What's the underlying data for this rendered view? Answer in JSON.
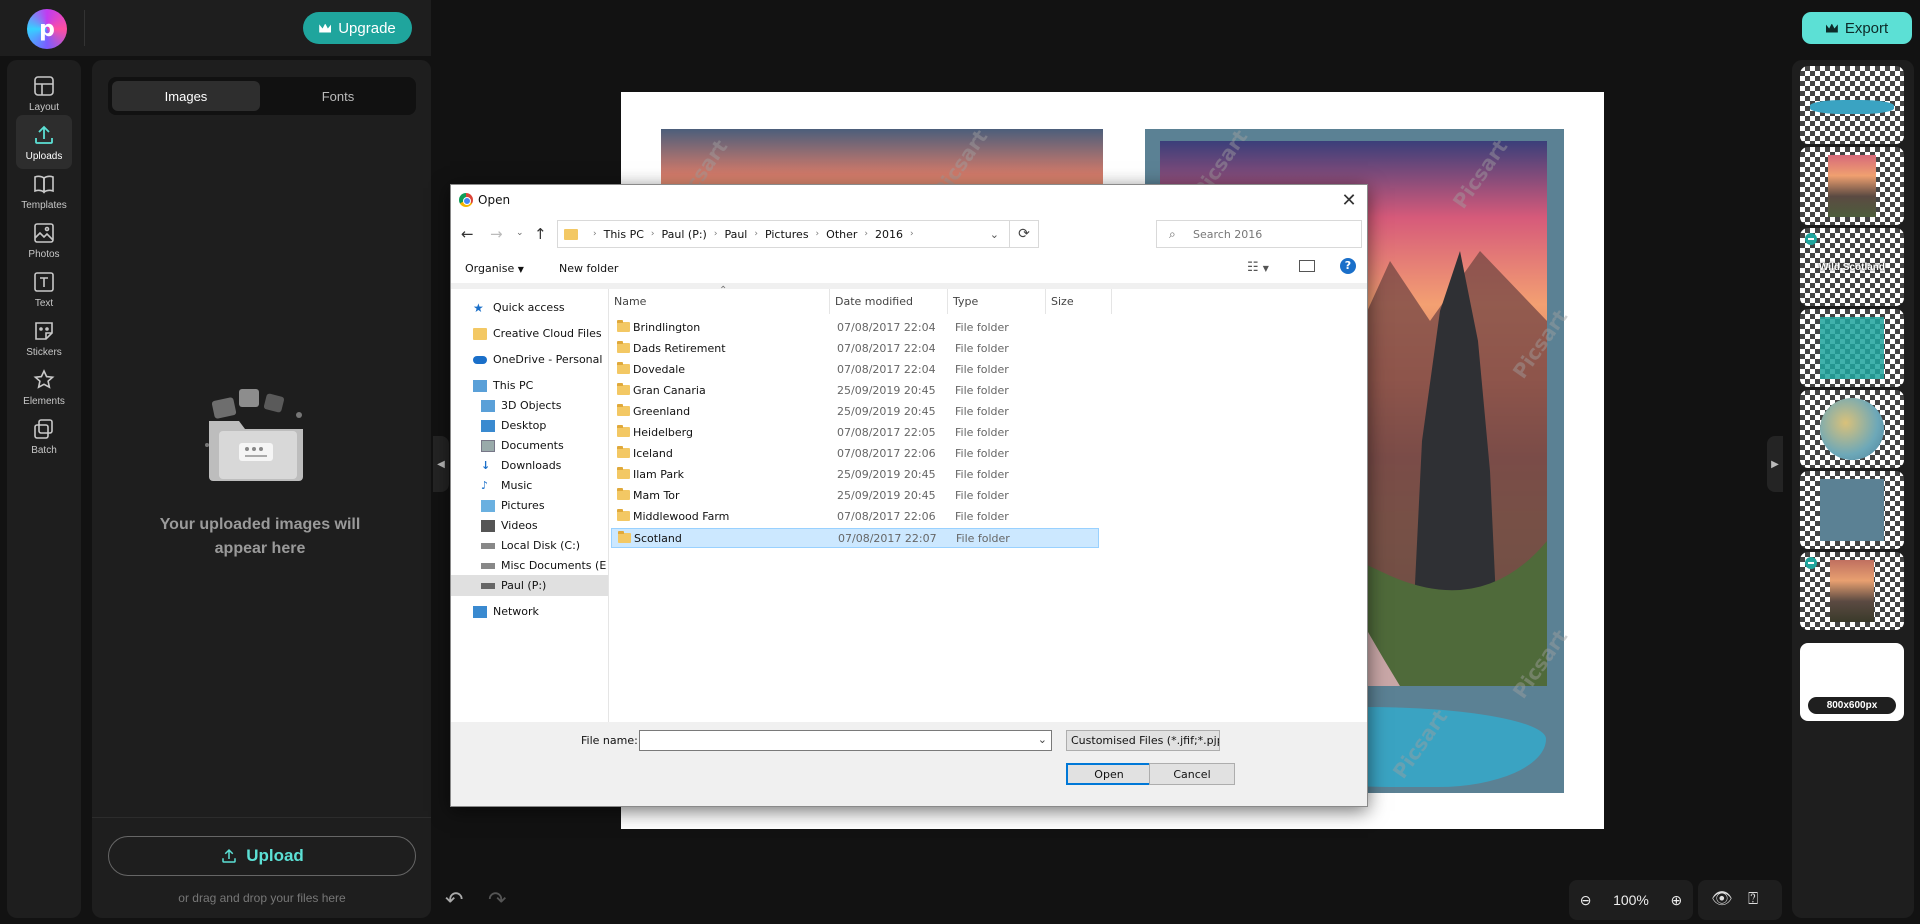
{
  "app": {
    "upgrade_label": "Upgrade",
    "export_label": "Export"
  },
  "rail": [
    {
      "label": "Layout",
      "icon": "layout-icon"
    },
    {
      "label": "Uploads",
      "icon": "upload-icon",
      "active": true
    },
    {
      "label": "Templates",
      "icon": "templates-icon"
    },
    {
      "label": "Photos",
      "icon": "photos-icon"
    },
    {
      "label": "Text",
      "icon": "text-icon"
    },
    {
      "label": "Stickers",
      "icon": "stickers-icon"
    },
    {
      "label": "Elements",
      "icon": "elements-icon"
    },
    {
      "label": "Batch",
      "icon": "batch-icon"
    }
  ],
  "panel": {
    "tabs": [
      {
        "label": "Images",
        "active": true
      },
      {
        "label": "Fonts"
      }
    ],
    "empty_line1": "Your uploaded images will",
    "empty_line2": "appear here",
    "upload_label": "Upload",
    "drag_hint": "or drag and drop your files here"
  },
  "zoom": {
    "level": "100%"
  },
  "thumbnails": {
    "wild_label": "Wild Scotland",
    "size_label": "800x600px"
  },
  "watermark": "Picsart",
  "dialog": {
    "title": "Open",
    "breadcrumb": [
      "This PC",
      "Paul (P:)",
      "Paul",
      "Pictures",
      "Other",
      "2016"
    ],
    "search_placeholder": "Search 2016",
    "organise_label": "Organise",
    "new_folder_label": "New folder",
    "nav": [
      {
        "label": "Quick access",
        "icon": "star-icon",
        "indent": 0
      },
      {
        "label": "Creative Cloud Files",
        "icon": "creative-cloud-icon",
        "indent": 0
      },
      {
        "label": "OneDrive - Personal",
        "icon": "onedrive-icon",
        "indent": 0
      },
      {
        "label": "This PC",
        "icon": "pc-icon",
        "indent": 0
      },
      {
        "label": "3D Objects",
        "icon": "3d-objects-icon",
        "indent": 1
      },
      {
        "label": "Desktop",
        "icon": "desktop-icon",
        "indent": 1
      },
      {
        "label": "Documents",
        "icon": "documents-icon",
        "indent": 1
      },
      {
        "label": "Downloads",
        "icon": "downloads-icon",
        "indent": 1
      },
      {
        "label": "Music",
        "icon": "music-icon",
        "indent": 1
      },
      {
        "label": "Pictures",
        "icon": "pictures-icon",
        "indent": 1
      },
      {
        "label": "Videos",
        "icon": "videos-icon",
        "indent": 1
      },
      {
        "label": "Local Disk (C:)",
        "icon": "disk-icon",
        "indent": 1
      },
      {
        "label": "Misc Documents (E",
        "icon": "disk-icon",
        "indent": 1
      },
      {
        "label": "Paul (P:)",
        "icon": "disk-icon",
        "indent": 1,
        "selected": true
      },
      {
        "label": "Network",
        "icon": "network-icon",
        "indent": 0
      }
    ],
    "columns": [
      "Name",
      "Date modified",
      "Type",
      "Size"
    ],
    "files": [
      {
        "name": "Brindlington",
        "date": "07/08/2017 22:04",
        "type": "File folder"
      },
      {
        "name": "Dads Retirement",
        "date": "07/08/2017 22:04",
        "type": "File folder"
      },
      {
        "name": "Dovedale",
        "date": "07/08/2017 22:04",
        "type": "File folder"
      },
      {
        "name": "Gran Canaria",
        "date": "25/09/2019 20:45",
        "type": "File folder"
      },
      {
        "name": "Greenland",
        "date": "25/09/2019 20:45",
        "type": "File folder"
      },
      {
        "name": "Heidelberg",
        "date": "07/08/2017 22:05",
        "type": "File folder"
      },
      {
        "name": "Iceland",
        "date": "07/08/2017 22:06",
        "type": "File folder"
      },
      {
        "name": "Ilam Park",
        "date": "25/09/2019 20:45",
        "type": "File folder"
      },
      {
        "name": "Mam Tor",
        "date": "25/09/2019 20:45",
        "type": "File folder"
      },
      {
        "name": "Middlewood Farm",
        "date": "07/08/2017 22:06",
        "type": "File folder"
      },
      {
        "name": "Scotland",
        "date": "07/08/2017 22:07",
        "type": "File folder",
        "selected": true
      }
    ],
    "file_name_label": "File name:",
    "file_name_value": "",
    "file_type": "Customised Files (*.jfif;*.pjp;*.jp",
    "open_label": "Open",
    "cancel_label": "Cancel"
  }
}
